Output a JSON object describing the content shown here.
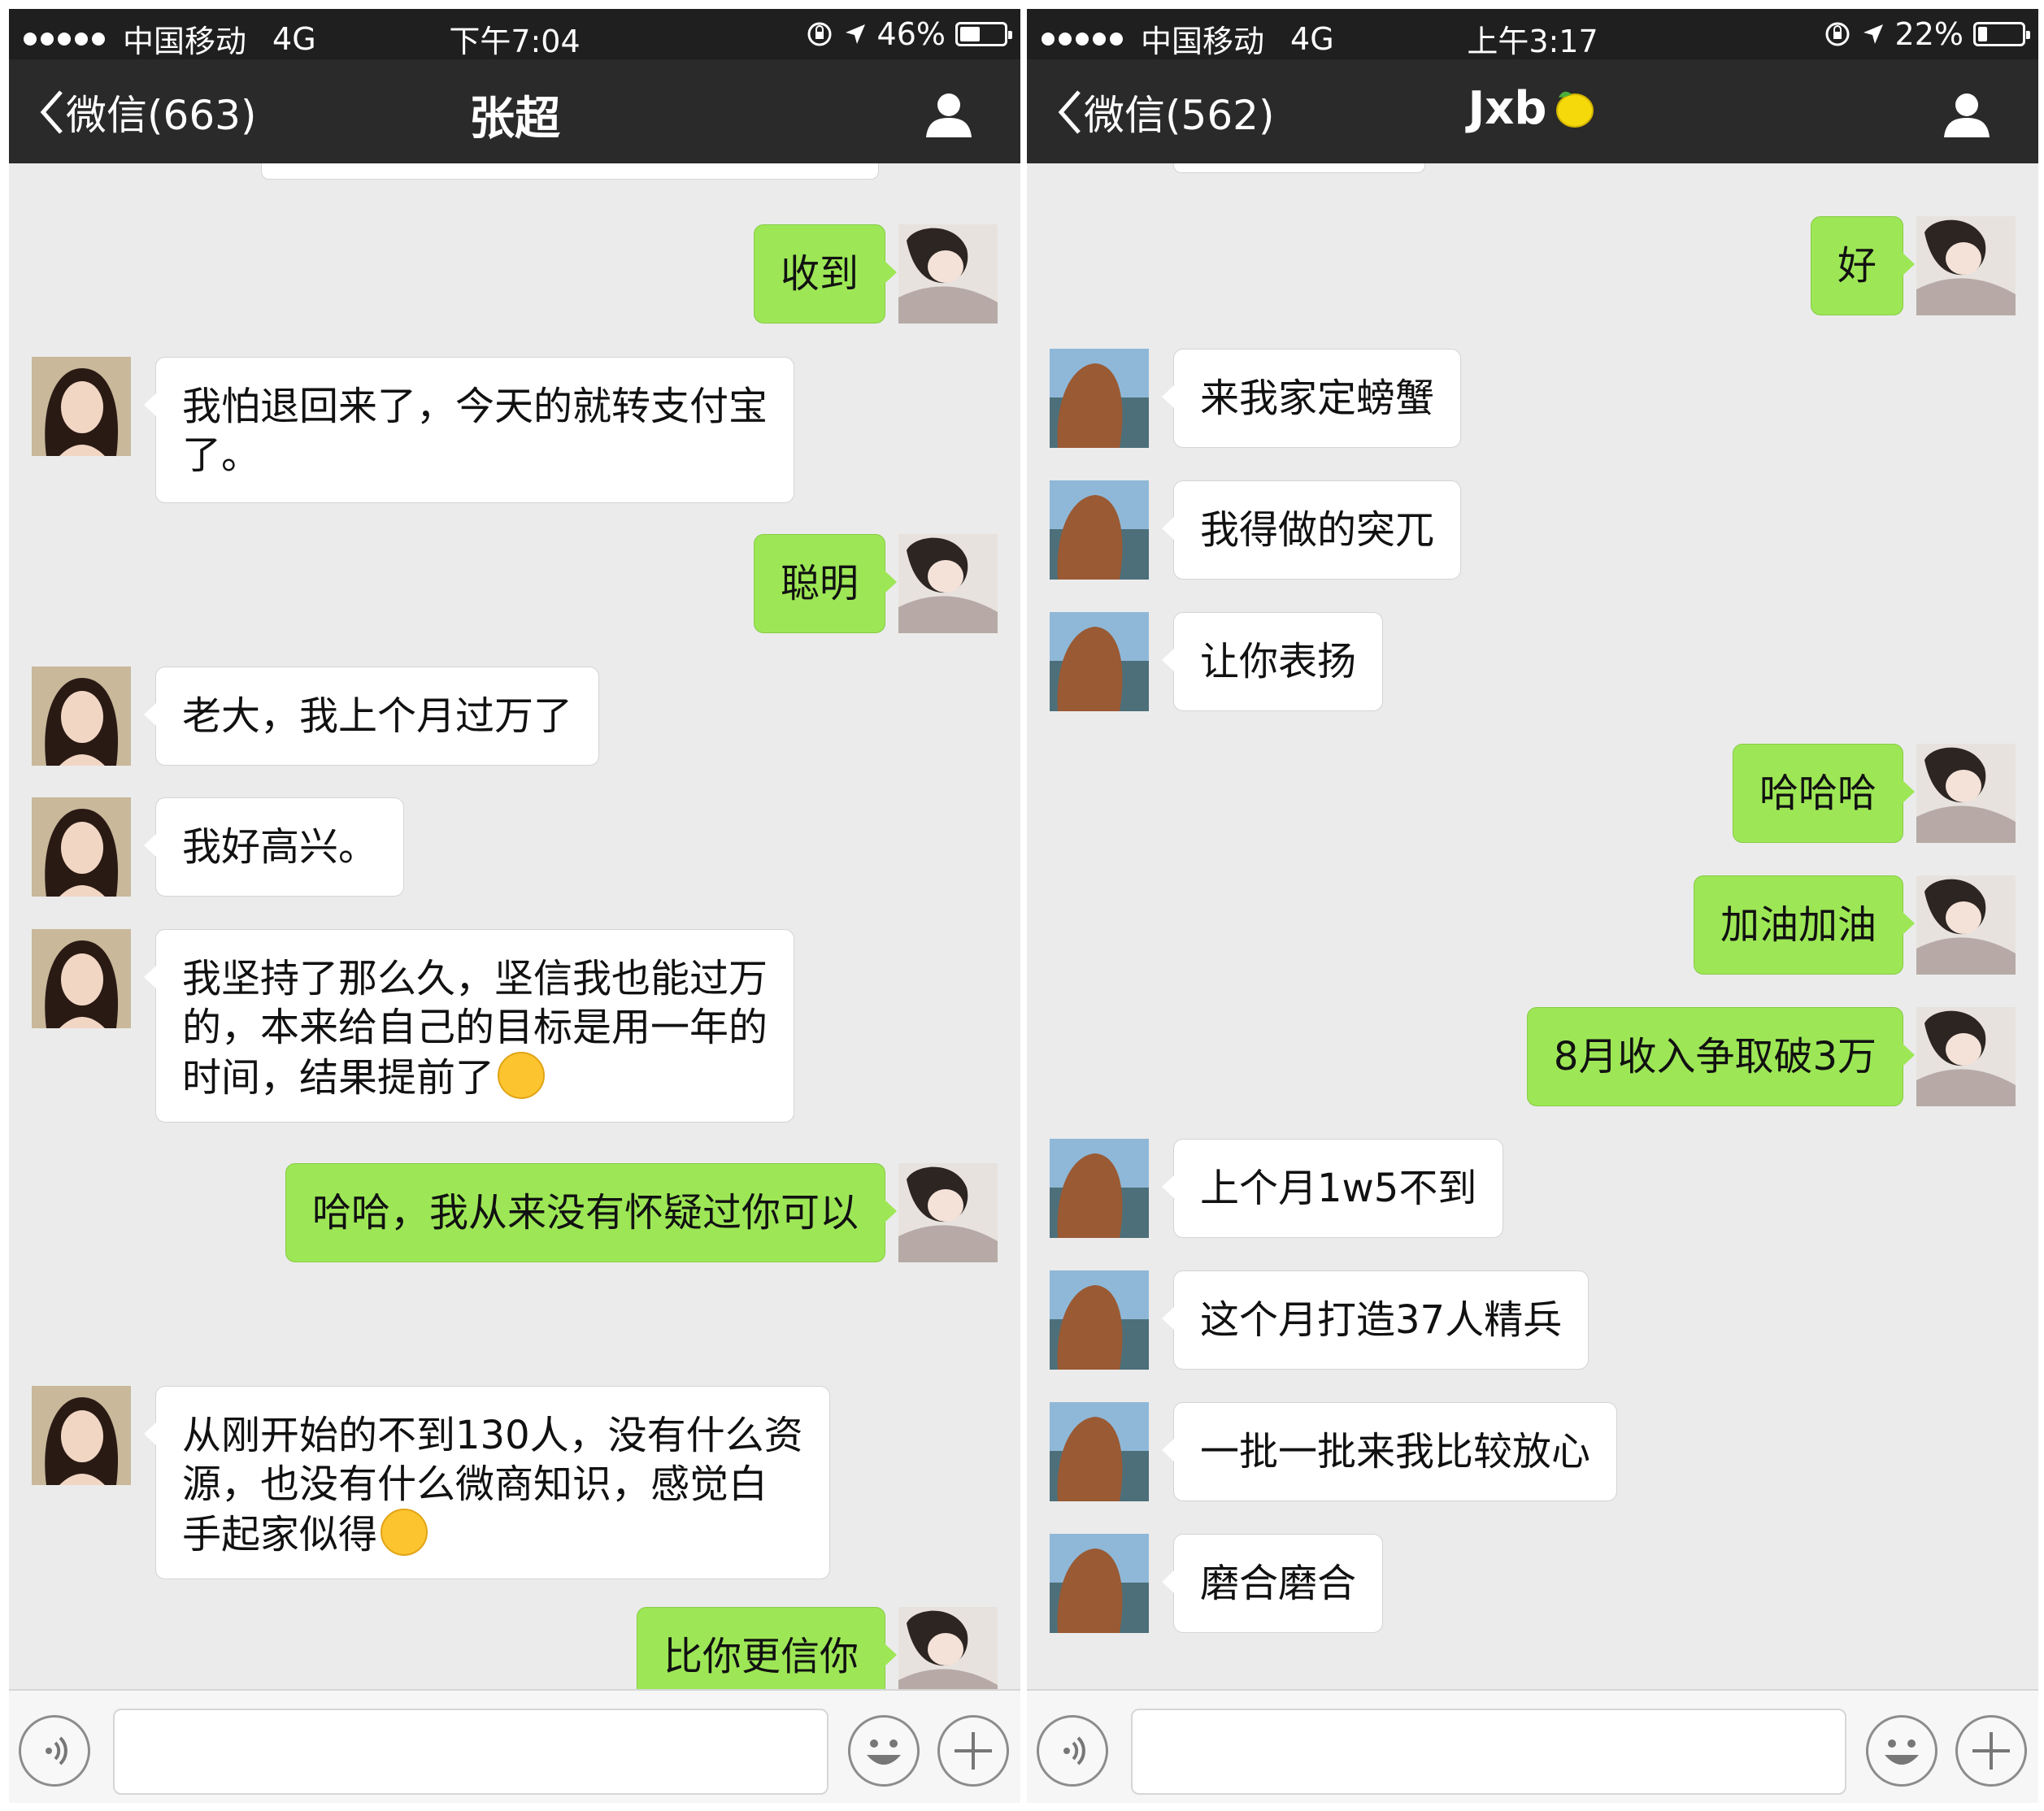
{
  "left_screen": {
    "status": {
      "carrier": "中国移动",
      "network": "4G",
      "time": "下午7:04",
      "battery_percent": "46%",
      "battery_level": 0.46
    },
    "nav": {
      "back_label": "微信(663)",
      "title": "张超",
      "user_icon": "person-icon"
    },
    "messages": [
      {
        "side": "out",
        "text": "收到"
      },
      {
        "side": "in",
        "lines": [
          "我怕退回来了，今天的就转支付宝",
          "了。"
        ]
      },
      {
        "side": "out",
        "text": "聪明"
      },
      {
        "side": "in",
        "text": "老大，我上个月过万了"
      },
      {
        "side": "in",
        "text": "我好高兴。"
      },
      {
        "side": "in",
        "lines": [
          "我坚持了那么久，坚信我也能过万",
          "的，本来给自己的目标是用一年的",
          "时间，结果提前了"
        ],
        "emoji": "hug-emoji"
      },
      {
        "side": "out",
        "text": "哈哈，我从来没有怀疑过你可以"
      },
      {
        "side": "in",
        "lines": [
          "从刚开始的不到130人，没有什么资",
          "源，也没有什么微商知识，感觉白",
          "手起家似得"
        ],
        "emoji": "laugh-cry-emoji"
      },
      {
        "side": "out",
        "text": "比你更信你"
      }
    ]
  },
  "right_screen": {
    "status": {
      "carrier": "中国移动",
      "network": "4G",
      "time": "上午3:17",
      "battery_percent": "22%",
      "battery_level": 0.22
    },
    "nav": {
      "back_label": "微信(562)",
      "title": "Jxb",
      "title_emoji": "lemon-emoji",
      "user_icon": "person-icon"
    },
    "messages": [
      {
        "side": "out",
        "text": "好"
      },
      {
        "side": "in",
        "text": "来我家定螃蟹"
      },
      {
        "side": "in",
        "text": "我得做的突兀"
      },
      {
        "side": "in",
        "text": "让你表扬"
      },
      {
        "side": "out",
        "text": "哈哈哈"
      },
      {
        "side": "out",
        "text": "加油加油"
      },
      {
        "side": "out",
        "text": "8月收入争取破3万"
      },
      {
        "side": "in",
        "text": "上个月1w5不到"
      },
      {
        "side": "in",
        "text": "这个月打造37人精兵"
      },
      {
        "side": "in",
        "text": "一批一批来我比较放心"
      },
      {
        "side": "in",
        "text": "磨合磨合"
      }
    ]
  },
  "input_bar": {
    "voice_icon": "voice-icon",
    "emoji_icon": "smiley-icon",
    "plus_icon": "plus-icon"
  },
  "colors": {
    "sent_bubble": "#9de756",
    "received_bubble": "#ffffff",
    "chat_bg": "#ebebeb",
    "nav_bg": "#2a2a2a"
  }
}
